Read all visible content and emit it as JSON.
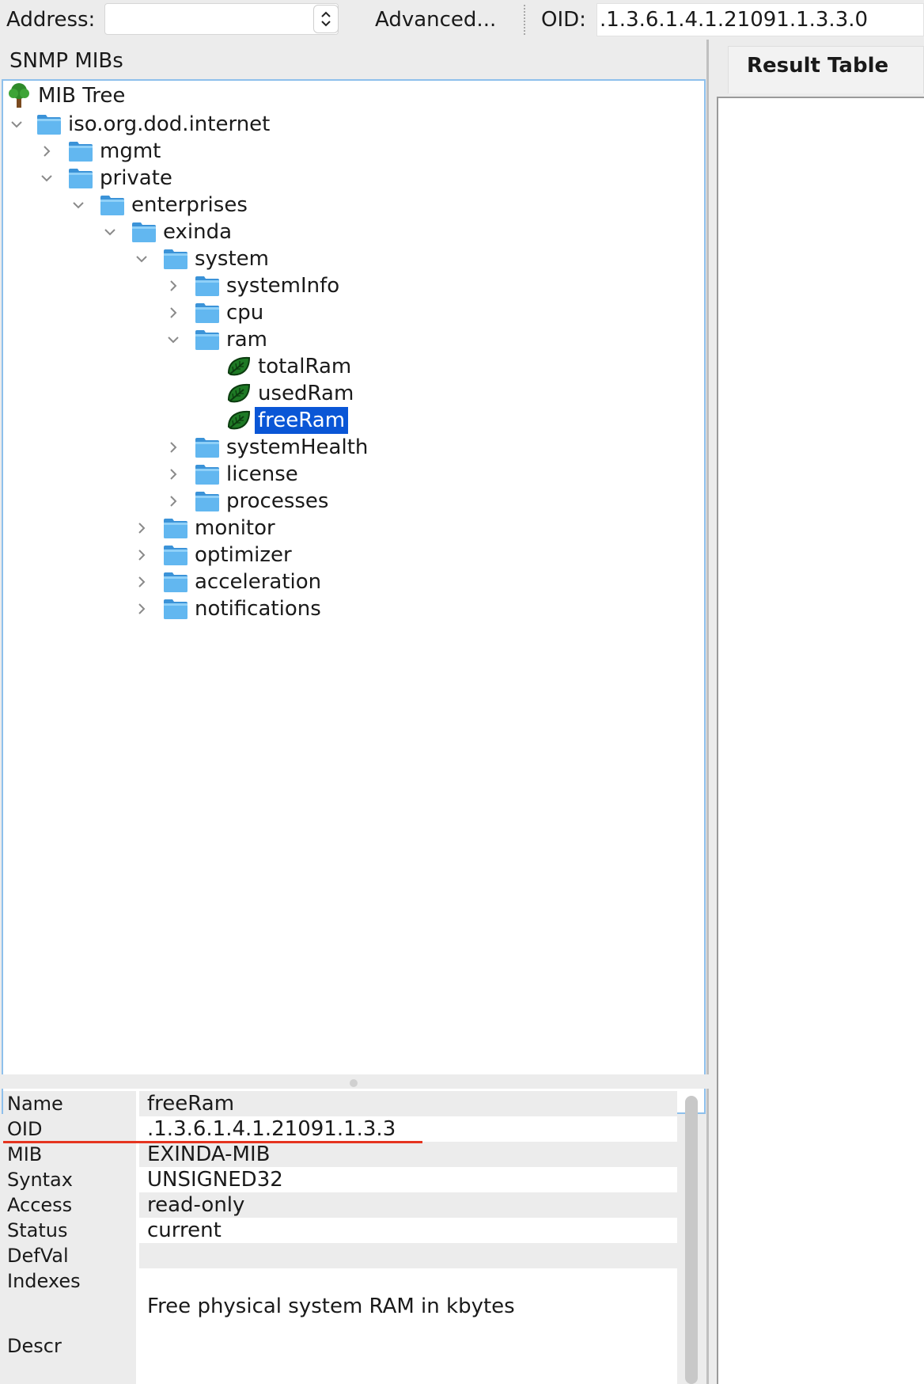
{
  "toolbar": {
    "address_label": "Address:",
    "address_value": "",
    "advanced_label": "Advanced...",
    "oid_label": "OID:",
    "oid_value": ".1.3.6.1.4.1.21091.1.3.3.0"
  },
  "left_pane": {
    "title": "SNMP MIBs"
  },
  "tree": {
    "root": "MIB Tree",
    "nodes": [
      {
        "label": "iso.org.dod.internet",
        "expanded": true
      },
      {
        "label": "mgmt",
        "expanded": false
      },
      {
        "label": "private",
        "expanded": true
      },
      {
        "label": "enterprises",
        "expanded": true
      },
      {
        "label": "exinda",
        "expanded": true
      },
      {
        "label": "system",
        "expanded": true
      },
      {
        "label": "systemInfo",
        "expanded": false
      },
      {
        "label": "cpu",
        "expanded": false
      },
      {
        "label": "ram",
        "expanded": true
      },
      {
        "label": "totalRam"
      },
      {
        "label": "usedRam"
      },
      {
        "label": "freeRam",
        "selected": true
      },
      {
        "label": "systemHealth",
        "expanded": false
      },
      {
        "label": "license",
        "expanded": false
      },
      {
        "label": "processes",
        "expanded": false
      },
      {
        "label": "monitor",
        "expanded": false
      },
      {
        "label": "optimizer",
        "expanded": false
      },
      {
        "label": "acceleration",
        "expanded": false
      },
      {
        "label": "notifications",
        "expanded": false
      }
    ]
  },
  "properties": [
    {
      "name": "Name",
      "value": "freeRam"
    },
    {
      "name": "OID",
      "value": ".1.3.6.1.4.1.21091.1.3.3"
    },
    {
      "name": "MIB",
      "value": "EXINDA-MIB"
    },
    {
      "name": "Syntax",
      "value": "UNSIGNED32"
    },
    {
      "name": "Access",
      "value": "read-only"
    },
    {
      "name": "Status",
      "value": "current"
    },
    {
      "name": "DefVal",
      "value": ""
    },
    {
      "name": "Indexes",
      "value": ""
    },
    {
      "name": "Descr",
      "value": "Free physical system RAM in kbytes"
    }
  ],
  "right_pane": {
    "tab_label": "Result Table"
  },
  "colors": {
    "selection": "#0a56d6",
    "folder": "#5aaeea",
    "leaf": "#1e7a25",
    "highlight_line": "#e5341f",
    "tree_border": "#8ec0ec"
  }
}
